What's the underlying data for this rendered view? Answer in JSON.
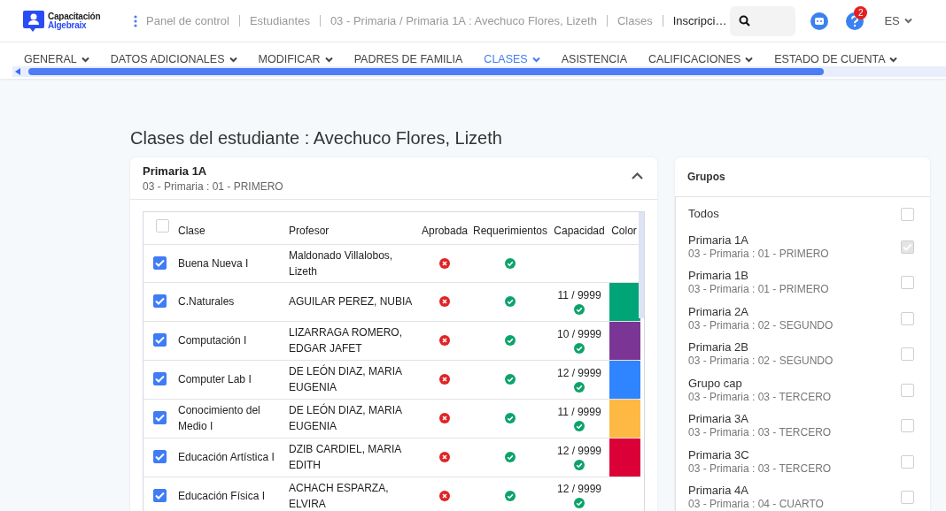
{
  "logo": {
    "line1": "Capacitación",
    "line2": "Algebraix"
  },
  "breadcrumb": [
    "Panel de control",
    "Estudiantes",
    "03 - Primaria / Primaria 1A : Avechuco Flores, Lizeth",
    "Clases",
    "Inscripci…"
  ],
  "help_badge": "2",
  "language": "ES",
  "tabs": [
    {
      "label": "GENERAL",
      "has_menu": true,
      "selected": false
    },
    {
      "label": "DATOS ADICIONALES",
      "has_menu": true,
      "selected": false
    },
    {
      "label": "MODIFICAR",
      "has_menu": true,
      "selected": false
    },
    {
      "label": "PADRES DE FAMILIA",
      "has_menu": false,
      "selected": false
    },
    {
      "label": "CLASES",
      "has_menu": true,
      "selected": true
    },
    {
      "label": "ASISTENCIA",
      "has_menu": false,
      "selected": false
    },
    {
      "label": "CALIFICACIONES",
      "has_menu": true,
      "selected": false
    },
    {
      "label": "ESTADO DE CUENTA",
      "has_menu": true,
      "selected": false
    }
  ],
  "page_title": "Clases del estudiante : Avechuco Flores, Lizeth",
  "group_card": {
    "title": "Primaria 1A",
    "subtitle": "03 - Primaria : 01 - PRIMERO",
    "expanded": true
  },
  "table": {
    "select_all_checked": false,
    "columns": [
      "Clase",
      "Profesor",
      "Aprobada",
      "Requerimientos",
      "Capacidad",
      "Color"
    ],
    "rows": [
      {
        "checked": true,
        "clase": "Buena Nueva I",
        "profesor": "Maldonado Villalobos, Lizeth",
        "aprobada": false,
        "requerimientos": true
      },
      {
        "checked": true,
        "clase": "C.Naturales",
        "profesor": "AGUILAR PEREZ, NUBIA",
        "aprobada": false,
        "requerimientos": true,
        "capacidad": "11 / 9999",
        "capacidad_ok": true,
        "color": "#00a577"
      },
      {
        "checked": true,
        "clase": "Computación I",
        "profesor": "LIZARRAGA ROMERO, EDGAR JAFET",
        "aprobada": false,
        "requerimientos": true,
        "capacidad": "10 / 9999",
        "capacidad_ok": true,
        "color": "#7b3594"
      },
      {
        "checked": true,
        "clase": "Computer Lab I",
        "profesor": "DE LEÓN DIAZ, MARIA EUGENIA",
        "aprobada": false,
        "requerimientos": true,
        "capacidad": "12 / 9999",
        "capacidad_ok": true,
        "color": "#2f84ff"
      },
      {
        "checked": true,
        "clase": "Conocimiento del Medio I",
        "profesor": "DE LEÓN DIAZ, MARIA EUGENIA",
        "aprobada": false,
        "requerimientos": true,
        "capacidad": "11 / 9999",
        "capacidad_ok": true,
        "color": "#fdb944"
      },
      {
        "checked": true,
        "clase": "Educación Artística I",
        "profesor": "DZIB CARDIEL, MARIA EDITH",
        "aprobada": false,
        "requerimientos": true,
        "capacidad": "12 / 9999",
        "capacidad_ok": true,
        "color": "#dc0038"
      },
      {
        "checked": true,
        "clase": "Educación Física I",
        "profesor": "ACHACH ESPARZA, ELVIRA",
        "aprobada": false,
        "requerimientos": true,
        "capacidad": "12 / 9999",
        "capacidad_ok": true
      }
    ]
  },
  "groups": {
    "title": "Grupos",
    "all": {
      "label": "Todos",
      "checked": false
    },
    "items": [
      {
        "name": "Primaria 1A",
        "detail": "03 - Primaria : 01 - PRIMERO",
        "checked": true,
        "disabled": true
      },
      {
        "name": "Primaria 1B",
        "detail": "03 - Primaria : 01 - PRIMERO",
        "checked": false,
        "disabled": false
      },
      {
        "name": "Primaria 2A",
        "detail": "03 - Primaria : 02 - SEGUNDO",
        "checked": false,
        "disabled": false
      },
      {
        "name": "Primaria 2B",
        "detail": "03 - Primaria : 02 - SEGUNDO",
        "checked": false,
        "disabled": false
      },
      {
        "name": "Grupo cap",
        "detail": "03 - Primaria : 03 - TERCERO",
        "checked": false,
        "disabled": false
      },
      {
        "name": "Primaria 3A",
        "detail": "03 - Primaria : 03 - TERCERO",
        "checked": false,
        "disabled": false
      },
      {
        "name": "Primaria 3C",
        "detail": "03 - Primaria : 03 - TERCERO",
        "checked": false,
        "disabled": false
      },
      {
        "name": "Primaria 4A",
        "detail": "03 - Primaria : 04 - CUARTO",
        "checked": false,
        "disabled": false
      }
    ]
  }
}
